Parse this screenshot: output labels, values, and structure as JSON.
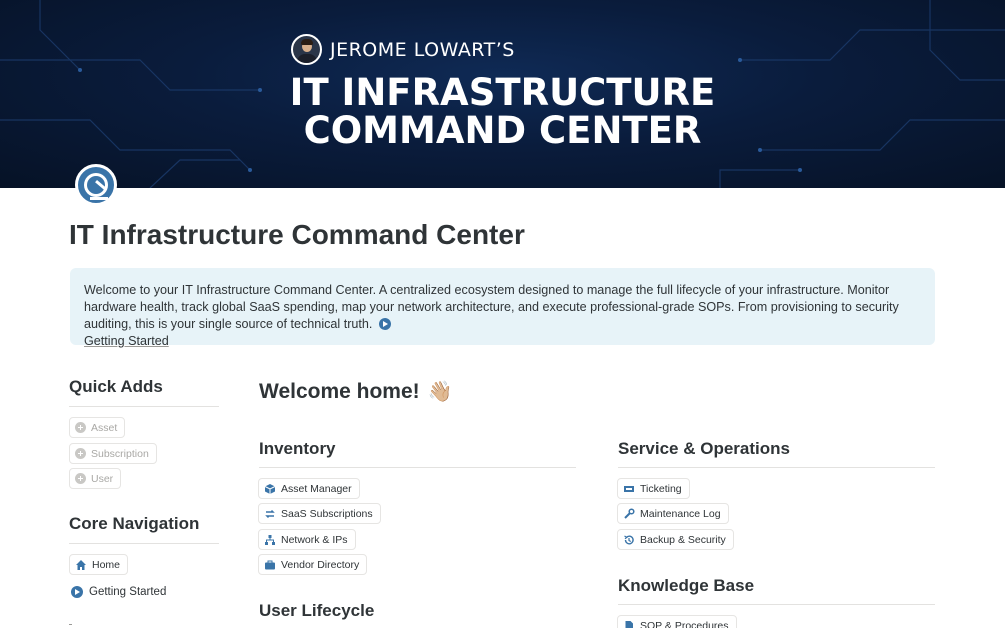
{
  "banner": {
    "owner": "JEROME LOWART’S",
    "title_line1": "IT INFRASTRUCTURE",
    "title_line2": "COMMAND CENTER"
  },
  "page": {
    "icon": "gauge-icon",
    "title": "IT Infrastructure Command Center"
  },
  "callout": {
    "text": "Welcome to your IT Infrastructure Command Center. A centralized ecosystem designed to manage the full lifecycle of your infrastructure. Monitor hardware health, track global SaaS spending, map your network architecture, and execute professional-grade SOPs. From provisioning to security auditing, this is your single source of technical truth.",
    "link_icon": "play-circle-icon",
    "link_label": "Getting Started"
  },
  "sidebar": {
    "quick_adds": {
      "heading": "Quick Adds",
      "items": [
        {
          "label": "Asset",
          "icon": "plus-circle-icon"
        },
        {
          "label": "Subscription",
          "icon": "plus-circle-icon"
        },
        {
          "label": "User",
          "icon": "plus-circle-icon"
        }
      ]
    },
    "core_navigation": {
      "heading": "Core Navigation",
      "items": [
        {
          "label": "Home",
          "icon": "home-icon"
        },
        {
          "label": "Getting Started",
          "icon": "play-circle-icon"
        }
      ]
    }
  },
  "main": {
    "welcome": "Welcome home!",
    "welcome_emoji": "👋🏼",
    "inventory": {
      "heading": "Inventory",
      "items": [
        {
          "label": "Asset Manager",
          "icon": "cube-icon"
        },
        {
          "label": "SaaS Subscriptions",
          "icon": "sync-icon"
        },
        {
          "label": "Network & IPs",
          "icon": "network-icon"
        },
        {
          "label": "Vendor Directory",
          "icon": "briefcase-icon"
        }
      ]
    },
    "user_lifecycle": {
      "heading": "User Lifecycle"
    },
    "service_ops": {
      "heading": "Service & Operations",
      "items": [
        {
          "label": "Ticketing",
          "icon": "ticket-icon"
        },
        {
          "label": "Maintenance Log",
          "icon": "wrench-icon"
        },
        {
          "label": "Backup & Security",
          "icon": "history-icon"
        }
      ]
    },
    "knowledge_base": {
      "heading": "Knowledge Base",
      "items": [
        {
          "label": "SOP & Procedures",
          "icon": "document-icon"
        }
      ]
    }
  },
  "colors": {
    "accent": "#3a74a8",
    "callout_bg": "#e7f3f8",
    "banner_bg": "#0a1c3c"
  }
}
